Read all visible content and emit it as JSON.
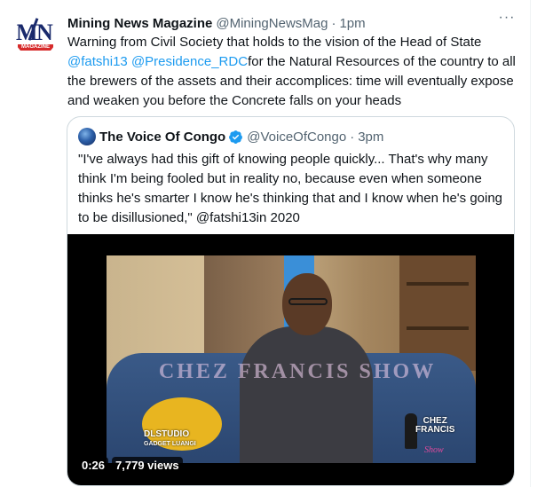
{
  "tweet": {
    "author_name": "Mining News Magazine",
    "author_handle": "@MiningNewsMag",
    "separator": "·",
    "time": "1pm",
    "more": "···",
    "avatar": {
      "logo_text": "MIN",
      "logo_band": "MAGAZINE"
    },
    "text_part1": "Warning from Civil Society that holds to the vision of the Head of State ",
    "mention1": "@fatshi13",
    "mention2": "@Presidence_RDC",
    "text_part2": "for the Natural Resources of the country to all the brewers of the assets and their accomplices: time will eventually expose and weaken you before the Concrete falls on your heads"
  },
  "quote": {
    "author_name": "The Voice Of Congo",
    "author_handle": "@VoiceOfCongo",
    "separator": "·",
    "time": "3pm",
    "text": "\"I've always had this gift of knowing people quickly... That's why many think I'm being fooled but in reality no, because even when someone thinks he's smarter I know he's thinking that and I know when he's going to be disillusioned,\" @fatshi13in 2020",
    "video": {
      "watermark": "CHEZ FRANCIS SHOW",
      "studio_line1": "DLSTUDIO",
      "studio_line2": "GADGET LUANGI",
      "show_logo_line1": "CHEZ",
      "show_logo_line2": "FRANCIS",
      "show_logo_line3": "Show",
      "duration": "0:26",
      "views": "7,779 views"
    }
  },
  "colors": {
    "link": "#1d9bf0",
    "secondary": "#536471",
    "border": "#cfd9de",
    "verified": "#1d9bf0"
  },
  "icons": {
    "more": "more-horizontal-icon",
    "verified": "verified-badge-icon"
  }
}
